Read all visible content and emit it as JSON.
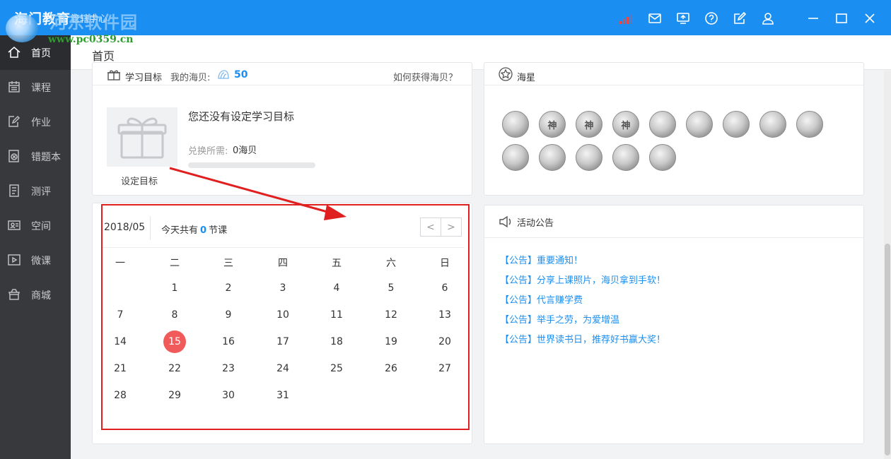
{
  "titlebar": {
    "app_title": "海门教育",
    "app_subtitle": "管辖中心",
    "watermark_big": "河东软件园",
    "watermark_url": "www.pc0359.cn",
    "icons": [
      "signal-icon",
      "mail-icon",
      "screen-share-icon",
      "help-icon",
      "edit-icon",
      "user-icon",
      "minimize-icon",
      "maximize-icon",
      "close-icon"
    ]
  },
  "sidebar": {
    "items": [
      {
        "label": "首页",
        "icon": "home-icon",
        "active": true
      },
      {
        "label": "课程",
        "icon": "calendar-icon"
      },
      {
        "label": "作业",
        "icon": "homework-icon"
      },
      {
        "label": "错题本",
        "icon": "wrong-book-icon"
      },
      {
        "label": "测评",
        "icon": "test-icon"
      },
      {
        "label": "空间",
        "icon": "space-icon"
      },
      {
        "label": "微课",
        "icon": "video-icon"
      },
      {
        "label": "商城",
        "icon": "shop-icon"
      }
    ]
  },
  "header": {
    "title": "首页"
  },
  "goal": {
    "head_title": "学习目标",
    "haibei_label": "我的海贝:",
    "haibei_value": "50",
    "how_link": "如何获得海贝？",
    "empty_title": "您还没有设定学习目标",
    "cost_label": "兑换所需:",
    "cost_value": "0海贝",
    "progress": 0,
    "set_goal": "设定目标"
  },
  "stars": {
    "title": "海星",
    "medals_row1": [
      "",
      "神",
      "神",
      "神",
      "",
      "",
      "",
      "",
      ""
    ],
    "medals_row2": [
      "",
      "",
      "",
      "",
      ""
    ]
  },
  "calendar": {
    "month": "2018/05",
    "today_prefix": "今天共有",
    "today_count": "0",
    "today_suffix": "节课",
    "prev": "<",
    "next": ">",
    "weekdays": [
      "一",
      "二",
      "三",
      "四",
      "五",
      "六",
      "日"
    ],
    "weeks": [
      [
        "",
        "1",
        "2",
        "3",
        "4",
        "5",
        "6"
      ],
      [
        "7",
        "8",
        "9",
        "10",
        "11",
        "12",
        "13"
      ],
      [
        "14",
        "15",
        "16",
        "17",
        "18",
        "19",
        "20"
      ],
      [
        "21",
        "22",
        "23",
        "24",
        "25",
        "26",
        "27"
      ],
      [
        "28",
        "29",
        "30",
        "31",
        "",
        "",
        ""
      ]
    ],
    "today": "15"
  },
  "notices": {
    "title": "活动公告",
    "items": [
      "【公告】重要通知！",
      "【公告】分享上课照片，海贝拿到手软！",
      "【公告】代言赚学费",
      "【公告】举手之劳，为爱增温",
      "【公告】世界读书日，推荐好书赢大奖！"
    ]
  },
  "colors": {
    "accent": "#1b8ff1",
    "sidebar": "#37393d",
    "today": "#f05a5a",
    "highlight": "#e02020"
  }
}
